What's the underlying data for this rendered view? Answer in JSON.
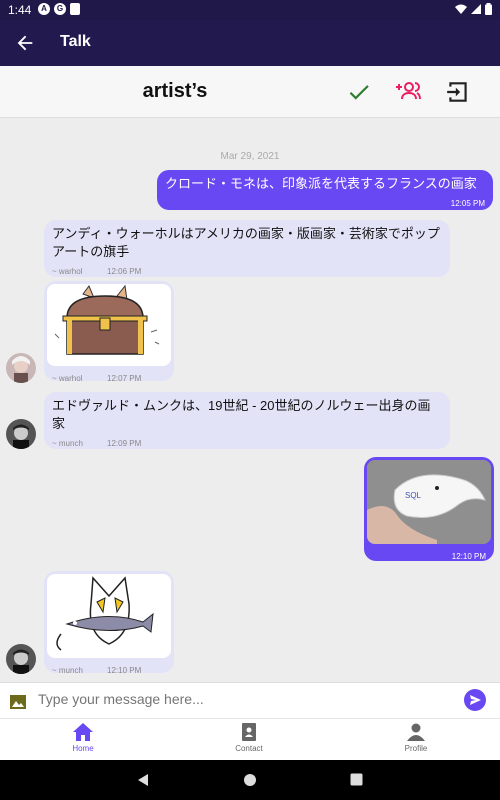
{
  "status_bar": {
    "time": "1:44",
    "icons": [
      "launcher-icon",
      "sync-icon",
      "sim-icon"
    ]
  },
  "app_bar": {
    "title": "Talk"
  },
  "chat_header": {
    "name": "artist’s"
  },
  "messages": {
    "date": "Mar 29, 2021",
    "m1": {
      "text": "クロード・モネは、印象派を代表するフランスの画家",
      "time": "12:05 PM"
    },
    "m2": {
      "text": "アンディ・ウォーホルはアメリカの画家・版画家・芸術家でポップアートの旗手",
      "sender": "~ warhol",
      "time": "12:06 PM"
    },
    "m3": {
      "sender": "~ warhol",
      "time": "12:07 PM",
      "image": "treasure-chest-cat-sticker"
    },
    "m4": {
      "text": "エドヴァルド・ムンクは、19世紀 - 20世紀のノルウェー出身の画家",
      "sender": "~ munch",
      "time": "12:09 PM"
    },
    "m5": {
      "time": "12:10 PM",
      "image": "dolphin-toy-photo"
    },
    "m6": {
      "sender": "~ munch",
      "time": "12:10 PM",
      "image": "cat-with-fish-sticker"
    }
  },
  "input": {
    "placeholder": "Type your message here..."
  },
  "bottom_nav": {
    "home": "Home",
    "contact": "Contact",
    "profile": "Profile"
  },
  "colors": {
    "accent": "#6848f2",
    "app_bar": "#221a4f",
    "incoming_bubble": "#e3e3f8",
    "add_user": "#e91e63",
    "check": "#2e7d32"
  }
}
